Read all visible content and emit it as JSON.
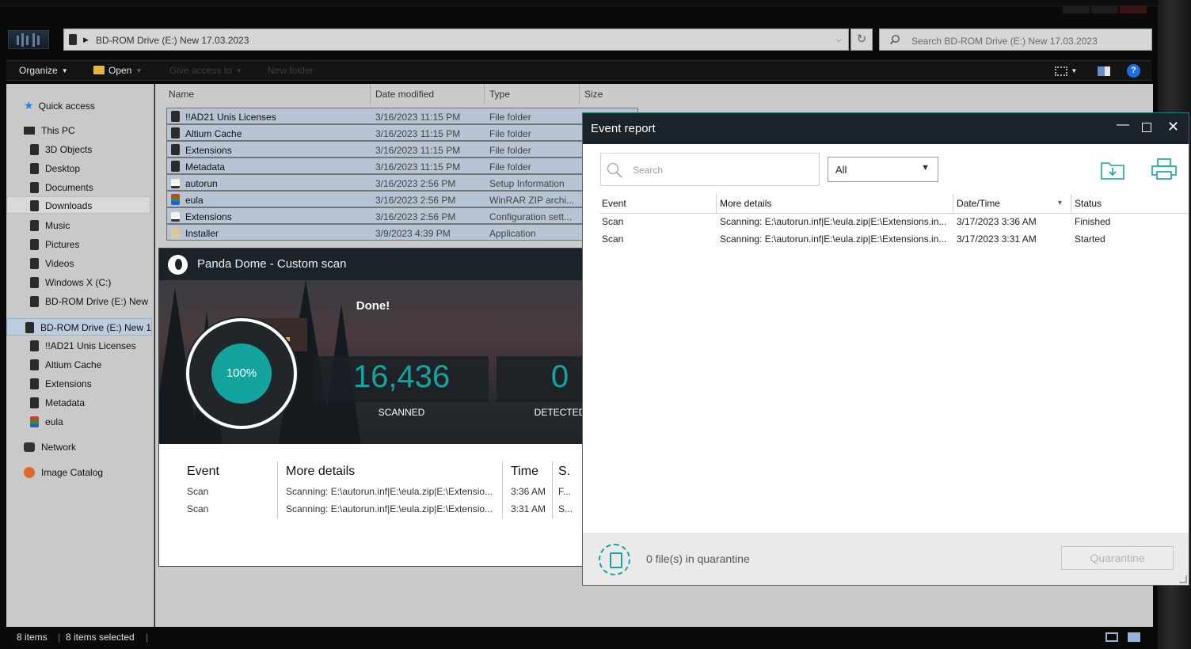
{
  "explorer": {
    "address": "BD-ROM Drive (E:) New 17.03.2023",
    "search_placeholder": "Search BD-ROM Drive (E:) New 17.03.2023",
    "commands": {
      "organize": "Organize",
      "open": "Open",
      "give_access": "Give access to",
      "new_folder": "New folder"
    },
    "nav": [
      {
        "label": "Quick access"
      },
      {
        "label": "This PC"
      },
      {
        "label": "3D Objects"
      },
      {
        "label": "Desktop"
      },
      {
        "label": "Documents"
      },
      {
        "label": "Downloads"
      },
      {
        "label": "Music"
      },
      {
        "label": "Pictures"
      },
      {
        "label": "Videos"
      },
      {
        "label": "Windows X (C:)"
      },
      {
        "label": "BD-ROM Drive (E:) New"
      },
      {
        "label": "BD-ROM Drive (E:) New 1"
      },
      {
        "label": "!!AD21 Unis Licenses"
      },
      {
        "label": "Altium Cache"
      },
      {
        "label": "Extensions"
      },
      {
        "label": "Metadata"
      },
      {
        "label": "eula"
      },
      {
        "label": "Network"
      },
      {
        "label": "Image Catalog"
      }
    ],
    "columns": {
      "name": "Name",
      "date": "Date modified",
      "type": "Type",
      "size": "Size"
    },
    "files": [
      {
        "name": "!!AD21 Unis Licenses",
        "date": "3/16/2023 11:15 PM",
        "type": "File folder"
      },
      {
        "name": "Altium Cache",
        "date": "3/16/2023 11:15 PM",
        "type": "File folder"
      },
      {
        "name": "Extensions",
        "date": "3/16/2023 11:15 PM",
        "type": "File folder"
      },
      {
        "name": "Metadata",
        "date": "3/16/2023 11:15 PM",
        "type": "File folder"
      },
      {
        "name": "autorun",
        "date": "3/16/2023 2:56 PM",
        "type": "Setup Information"
      },
      {
        "name": "eula",
        "date": "3/16/2023 2:56 PM",
        "type": "WinRAR ZIP archi..."
      },
      {
        "name": "Extensions",
        "date": "3/16/2023 2:56 PM",
        "type": "Configuration sett..."
      },
      {
        "name": "Installer",
        "date": "3/9/2023 4:39 PM",
        "type": "Application"
      }
    ],
    "status": {
      "count": "8 items",
      "selected": "8 items selected"
    }
  },
  "panda": {
    "title": "Panda Dome - Custom scan",
    "done": "Done!",
    "progress_label": "100%",
    "progress": 1.0,
    "scanned_value": "16,436",
    "scanned_label": "SCANNED",
    "detected_value": "0",
    "detected_label": "DETECTED",
    "columns": {
      "event": "Event",
      "details": "More details",
      "time": "Time",
      "status": "S."
    },
    "rows": [
      {
        "event": "Scan",
        "details": "Scanning: E:\\autorun.inf|E:\\eula.zip|E:\\Extensio...",
        "time": "3:36 AM",
        "status": "F..."
      },
      {
        "event": "Scan",
        "details": "Scanning: E:\\autorun.inf|E:\\eula.zip|E:\\Extensio...",
        "time": "3:31 AM",
        "status": "S..."
      }
    ]
  },
  "report": {
    "title": "Event report",
    "search_placeholder": "Search",
    "filter": "All",
    "columns": {
      "event": "Event",
      "details": "More details",
      "datetime": "Date/Time",
      "status": "Status"
    },
    "rows": [
      {
        "event": "Scan",
        "details": "Scanning: E:\\autorun.inf|E:\\eula.zip|E:\\Extensions.in...",
        "datetime": "3/17/2023 3:36 AM",
        "status": "Finished"
      },
      {
        "event": "Scan",
        "details": "Scanning: E:\\autorun.inf|E:\\eula.zip|E:\\Extensions.in...",
        "datetime": "3/17/2023 3:31 AM",
        "status": "Started"
      }
    ],
    "quarantine_text": "0 file(s) in quarantine",
    "quarantine_button": "Quarantine"
  },
  "colors": {
    "accent": "#14a49f",
    "titlebar": "#1c2328",
    "selection": "#b6c4d3"
  }
}
